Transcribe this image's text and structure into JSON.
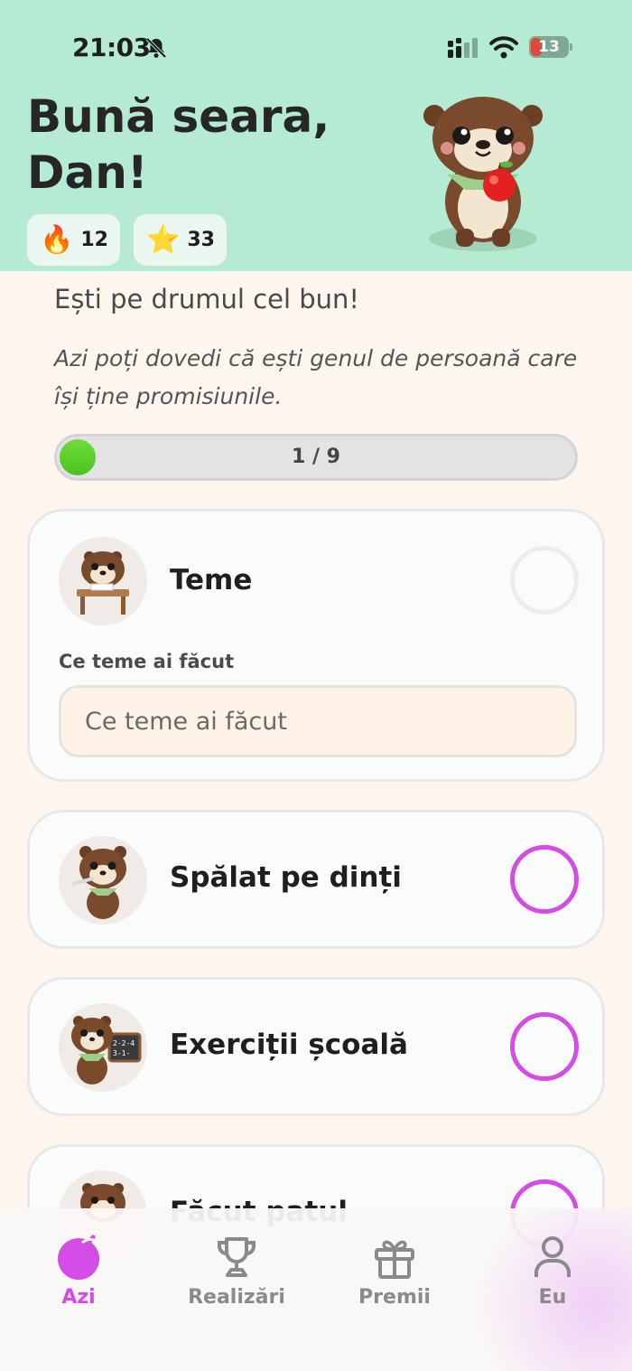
{
  "status_bar": {
    "time": "21:03",
    "battery": "13"
  },
  "header": {
    "greeting": "Bună seara, Dan!",
    "streak": {
      "icon": "fire-emoji",
      "value": "12"
    },
    "stars": {
      "icon": "star-emoji",
      "value": "33"
    }
  },
  "motivation": "Ești pe drumul cel bun!",
  "subtitle": "Azi poți dovedi că ești genul de persoană care își ține promisiunile.",
  "progress": {
    "label": "1 / 9",
    "done": 1,
    "total": 9
  },
  "tasks": [
    {
      "title": "Teme",
      "field_label": "Ce teme ai făcut",
      "field_placeholder": "Ce teme ai făcut",
      "field_value": ""
    },
    {
      "title": "Spălat pe dinți"
    },
    {
      "title": "Exerciții școală"
    },
    {
      "title": "Făcut patul"
    }
  ],
  "tabs": [
    {
      "label": "Azi",
      "icon": "apple-icon",
      "active": true
    },
    {
      "label": "Realizări",
      "icon": "trophy-icon",
      "active": false
    },
    {
      "label": "Premii",
      "icon": "gift-icon",
      "active": false
    },
    {
      "label": "Eu",
      "icon": "user-icon",
      "active": false
    }
  ],
  "colors": {
    "header_bg": "#b5ead3",
    "page_bg": "#fdf6ee",
    "accent": "#d54be6",
    "progress_fill": "#5ccf2a"
  }
}
